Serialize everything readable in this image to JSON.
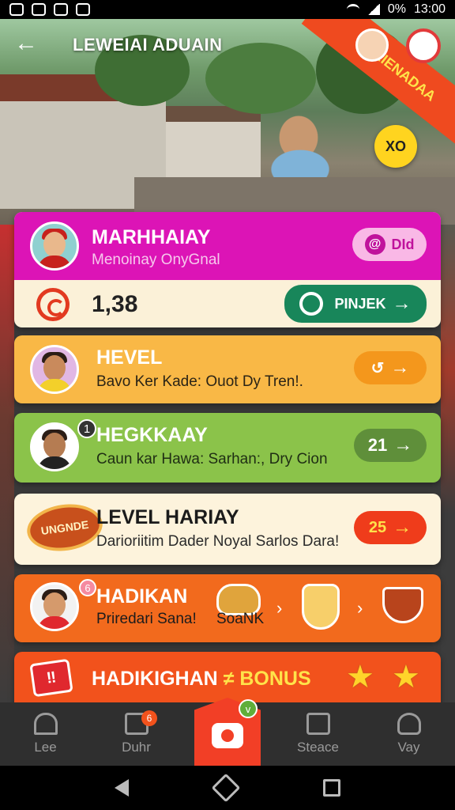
{
  "status_bar": {
    "battery": "0%",
    "time": "13:00"
  },
  "header": {
    "back_icon": "arrow-left-icon",
    "title": "LEWEIAI ADUAIN",
    "ribbon_text": "HAEIENADAA",
    "badge_text": "XO"
  },
  "cards": [
    {
      "title": "MARHHAIAY",
      "subtitle": "Menoinay OnyGnal",
      "tag": "DId",
      "count": "1,38",
      "action": "PINJEK",
      "color": "#dc14b6"
    },
    {
      "title": "HEVEL",
      "subtitle": "Bavo Ker Kade: Ouot Dy Tren!.",
      "color": "#f9b846"
    },
    {
      "title": "HEGKKAAY",
      "subtitle": "Caun kar Hawa: Sarhan:, Dry Cion",
      "badge": "1",
      "value": "21",
      "color": "#8bc34a"
    },
    {
      "title": "LEVEL HARIAY",
      "subtitle": "Darioriitim Dader Noyal Sarlos Dara!",
      "logo_text": "UNGNDE",
      "value": "25",
      "color": "#fdf3dc"
    },
    {
      "title": "HADIKAN",
      "subtitle": "Priredari Sana!",
      "badge": "6",
      "item_label": "SoaNK",
      "color": "#f26a1d"
    },
    {
      "title": "HADIKIGHAN",
      "title_bonus": "≠ BONUS",
      "color": "#f2521c"
    }
  ],
  "bottom_nav": [
    {
      "label": "Lee",
      "icon": "home-icon"
    },
    {
      "label": "Duhr",
      "icon": "store-icon",
      "badge": "6"
    },
    {
      "label": "",
      "icon": "camera-icon",
      "badge": "v"
    },
    {
      "label": "Steace",
      "icon": "list-icon"
    },
    {
      "label": "Vay",
      "icon": "user-icon"
    }
  ]
}
